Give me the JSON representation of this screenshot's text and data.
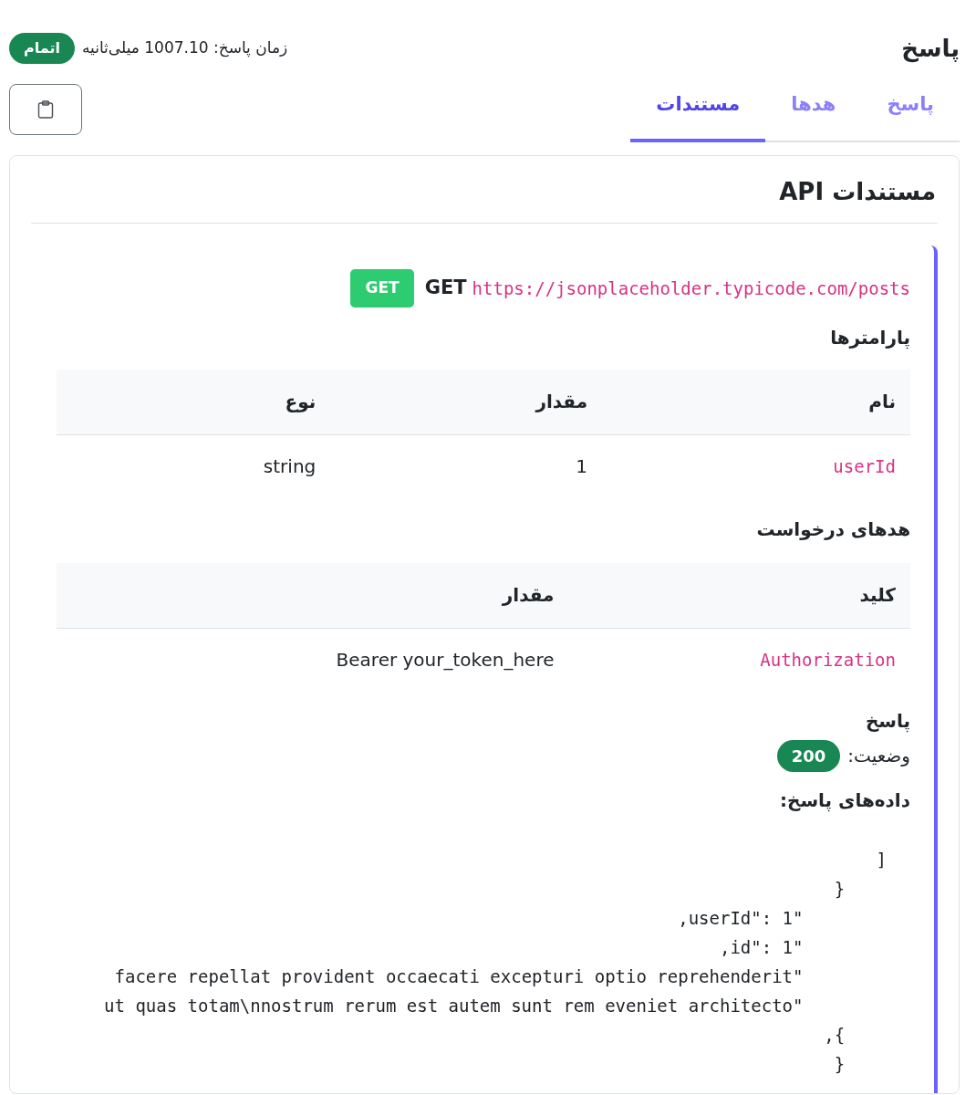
{
  "header": {
    "title": "پاسخ",
    "status_badge": "اتمام",
    "response_time": "زمان پاسخ: 1007.10 میلی‌ثانیه"
  },
  "tabs": [
    {
      "label": "پاسخ",
      "selected": false
    },
    {
      "label": "هدها",
      "selected": false
    },
    {
      "label": "مستندات",
      "selected": true
    }
  ],
  "docs": {
    "title": "مستندات API",
    "method_badge": "GET",
    "method": "GET",
    "url": "https://jsonplaceholder.typicode.com/posts",
    "parameters": {
      "heading": "پارامترها",
      "columns": [
        "نام",
        "مقدار",
        "نوع"
      ],
      "rows": [
        [
          "userId",
          "1",
          "string"
        ]
      ]
    },
    "request_headers": {
      "heading": "هدهای درخواست",
      "columns": [
        "کلید",
        "مقدار"
      ],
      "rows": [
        [
          "Authorization",
          "Bearer your_token_here"
        ]
      ]
    },
    "response": {
      "heading": "پاسخ",
      "status_label": "وضعیت:",
      "status_code": "200",
      "data_label": "داده‌های پاسخ:",
      "code_lines": [
        "]",
        "}    ",
        ",userId\": 1\"        ",
        ",id\": 1\"        ",
        "facere repellat provident occaecati excepturi optio reprehenderit\"        ",
        "ut quas totam\\nnostrum rerum est autem sunt rem eveniet architecto\"        ",
        ",{    ",
        "}    "
      ]
    }
  }
}
